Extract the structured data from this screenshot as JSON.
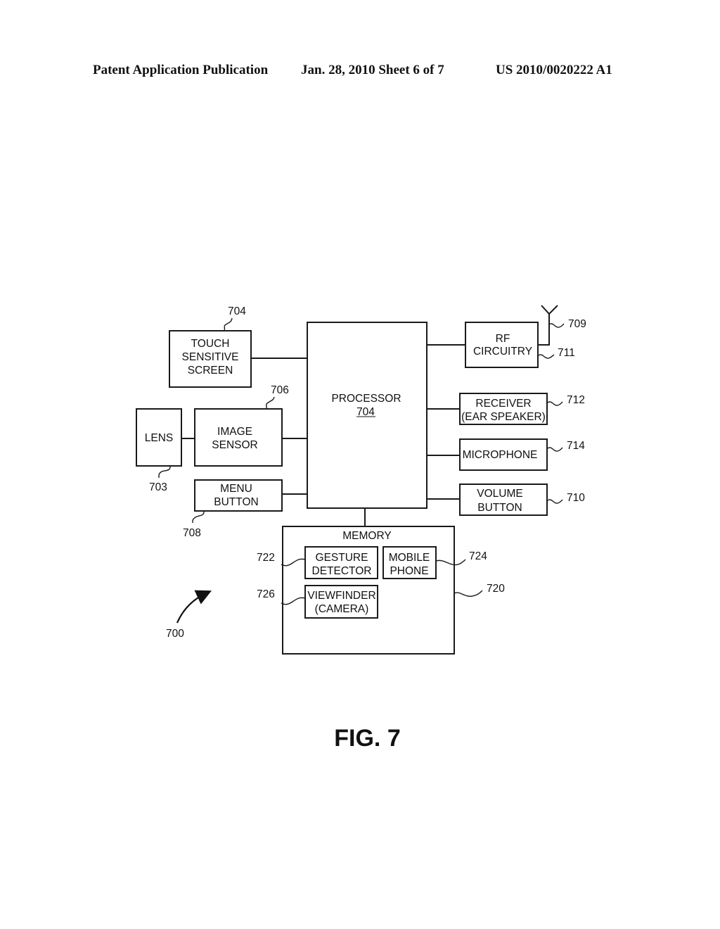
{
  "header": {
    "publication": "Patent Application Publication",
    "date_sheet": "Jan. 28, 2010   Sheet 6 of 7",
    "number": "US 2010/0020222 A1"
  },
  "figure": {
    "caption": "FIG. 7",
    "overall_ref": "700",
    "blocks": {
      "touch_screen": {
        "lines": [
          "TOUCH",
          "SENSITIVE",
          "SCREEN"
        ],
        "ref": "704"
      },
      "lens": {
        "lines": [
          "LENS"
        ],
        "ref": "703"
      },
      "image_sensor": {
        "lines": [
          "IMAGE",
          "SENSOR"
        ],
        "ref": "706"
      },
      "menu_button": {
        "lines": [
          "MENU",
          "BUTTON"
        ],
        "ref": "708"
      },
      "processor": {
        "lines": [
          "PROCESSOR"
        ],
        "ref": "704"
      },
      "rf_circuitry": {
        "lines": [
          "RF",
          "CIRCUITRY"
        ],
        "ref": "711",
        "antenna_ref": "709"
      },
      "receiver": {
        "lines": [
          "RECEIVER",
          "(EAR SPEAKER)"
        ],
        "ref": "712"
      },
      "microphone": {
        "lines": [
          "MICROPHONE"
        ],
        "ref": "714"
      },
      "volume_button": {
        "lines": [
          "VOLUME",
          "BUTTON"
        ],
        "ref": "710"
      },
      "memory": {
        "lines": [
          "MEMORY"
        ],
        "ref": "720"
      },
      "gesture_detector": {
        "lines": [
          "GESTURE",
          "DETECTOR"
        ],
        "ref": "722"
      },
      "mobile_phone": {
        "lines": [
          "MOBILE",
          "PHONE"
        ],
        "ref": "724"
      },
      "viewfinder": {
        "lines": [
          "VIEWFINDER",
          "(CAMERA)"
        ],
        "ref": "726"
      }
    }
  }
}
